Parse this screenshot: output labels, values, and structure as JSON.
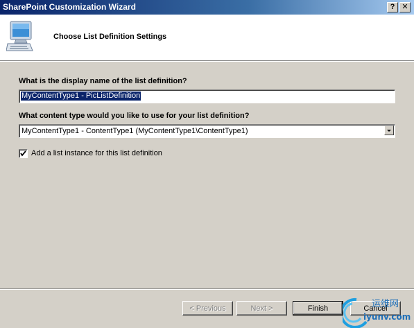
{
  "window": {
    "title": "SharePoint Customization Wizard",
    "help_glyph": "?",
    "close_glyph": "✕"
  },
  "header": {
    "title": "Choose List Definition Settings",
    "icon": "computer-icon"
  },
  "form": {
    "display_name_label": "What is the display name of the list definition?",
    "display_name_value": "MyContentType1 - PicListDefinition",
    "content_type_label": "What content type would you like to use for your list definition?",
    "content_type_value": "MyContentType1 - ContentType1 (MyContentType1\\ContentType1)",
    "add_instance_label": "Add a list instance for this list definition",
    "add_instance_checked": true,
    "checkmark_glyph": "✔"
  },
  "buttons": {
    "previous": "< Previous",
    "next": "Next >",
    "finish": "Finish",
    "cancel": "Cancel"
  },
  "watermark": {
    "line1": "运维网",
    "line2": "iyunv.com"
  }
}
